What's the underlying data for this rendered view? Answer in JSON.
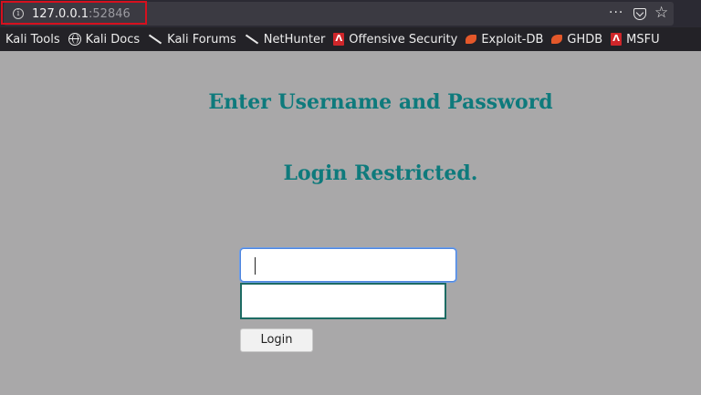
{
  "browser": {
    "url_host": "127.0.0.1",
    "url_port": ":52846",
    "menu_label": "···",
    "star_glyph": "☆",
    "info_glyph": "i"
  },
  "bookmarks": [
    {
      "label": "Kali Tools",
      "icon": "none"
    },
    {
      "label": "Kali Docs",
      "icon": "globe-icon"
    },
    {
      "label": "Kali Forums",
      "icon": "kali-dragon-icon"
    },
    {
      "label": "NetHunter",
      "icon": "kali-dragon-icon"
    },
    {
      "label": "Offensive Security",
      "icon": "offsec-icon"
    },
    {
      "label": "Exploit-DB",
      "icon": "exploit-db-icon"
    },
    {
      "label": "GHDB",
      "icon": "exploit-db-icon"
    },
    {
      "label": "MSFU",
      "icon": "offsec-icon"
    }
  ],
  "icon_glyphs": {
    "offsec": "Ʌ"
  },
  "page": {
    "heading": "Enter Username and Password",
    "subheading": "Login Restricted.",
    "username_value": "",
    "password_value": "",
    "login_label": "Login"
  },
  "colors": {
    "page_background": "#a9a8a9",
    "heading": "#0e7a7c",
    "highlight_box": "#d6101e"
  }
}
